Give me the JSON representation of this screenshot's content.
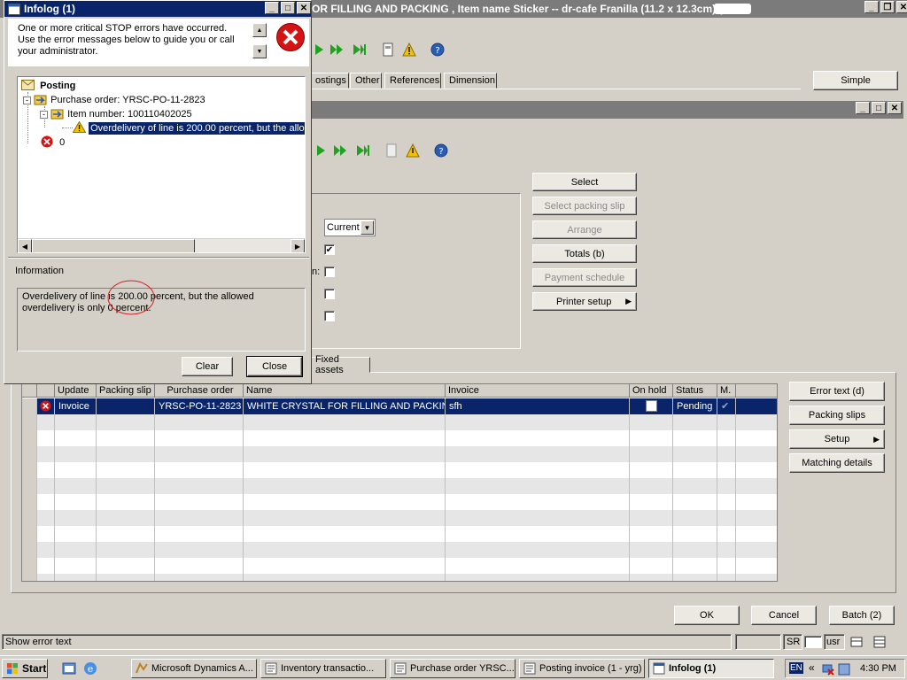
{
  "main_window": {
    "title": "OR FILLING AND PACKING , Item name Sticker -- dr-cafe Franilla (11.2 x 12.3cm) (",
    "tabs": [
      "ostings",
      "Other",
      "References",
      "Dimension"
    ],
    "simple_button": "Simple"
  },
  "buttons": {
    "select": "Select",
    "select_packing_slip": "Select packing slip",
    "arrange": "Arrange",
    "totals": "Totals (b)",
    "payment_schedule": "Payment schedule",
    "printer_setup": "Printer setup",
    "error_text": "Error text (d)",
    "packing_slips": "Packing slips",
    "setup": "Setup",
    "matching_details": "Matching details",
    "ok": "OK",
    "cancel": "Cancel",
    "batch": "Batch (2)"
  },
  "params": {
    "current_select": "Current",
    "label_n": "n:"
  },
  "fixed_assets_tab": "Fixed assets",
  "grid": {
    "headers": [
      "Update",
      "Packing slip",
      "Purchase order",
      "Name",
      "Invoice",
      "On hold",
      "Status",
      "M."
    ],
    "row": {
      "update": "Invoice",
      "packing_slip": "",
      "purchase_order": "YRSC-PO-11-2823",
      "name": "WHITE CRYSTAL FOR FILLING AND PACKING",
      "invoice": "sfh",
      "status": "Pending"
    }
  },
  "status_bar": {
    "text": "Show error text",
    "sr": "SR",
    "usr": "usr"
  },
  "infolog": {
    "title": "Infolog (1)",
    "header_message": "One or more critical STOP errors have occurred. Use the error messages below to guide you or call your administrator.",
    "tree": {
      "root": "Posting",
      "po": "Purchase order: YRSC-PO-11-2823",
      "item": "Item number: 100110402025",
      "message": "Overdelivery of line is 200.00 percent, but the allo",
      "zero": "0"
    },
    "info_label": "Information",
    "info_text": "Overdelivery of line is 200.00 percent, but the allowed overdelivery is only 0 percent.",
    "clear": "Clear",
    "close": "Close"
  },
  "taskbar": {
    "start": "Start",
    "items": [
      "Microsoft Dynamics A...",
      "Inventory transactio...",
      "Purchase order YRSC...",
      "Posting invoice (1 - yrg)",
      "Infolog (1)"
    ],
    "lang": "EN",
    "clock": "4:30 PM"
  }
}
